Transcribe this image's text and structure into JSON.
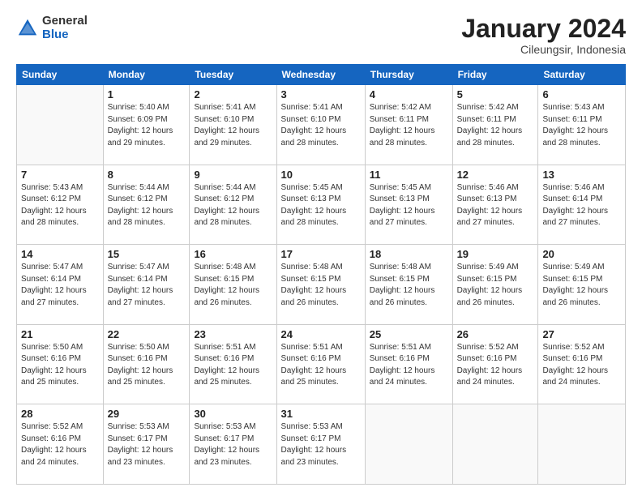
{
  "logo": {
    "general": "General",
    "blue": "Blue"
  },
  "header": {
    "month": "January 2024",
    "location": "Cileungsir, Indonesia"
  },
  "weekdays": [
    "Sunday",
    "Monday",
    "Tuesday",
    "Wednesday",
    "Thursday",
    "Friday",
    "Saturday"
  ],
  "weeks": [
    [
      {
        "day": "",
        "info": ""
      },
      {
        "day": "1",
        "info": "Sunrise: 5:40 AM\nSunset: 6:09 PM\nDaylight: 12 hours\nand 29 minutes."
      },
      {
        "day": "2",
        "info": "Sunrise: 5:41 AM\nSunset: 6:10 PM\nDaylight: 12 hours\nand 29 minutes."
      },
      {
        "day": "3",
        "info": "Sunrise: 5:41 AM\nSunset: 6:10 PM\nDaylight: 12 hours\nand 28 minutes."
      },
      {
        "day": "4",
        "info": "Sunrise: 5:42 AM\nSunset: 6:11 PM\nDaylight: 12 hours\nand 28 minutes."
      },
      {
        "day": "5",
        "info": "Sunrise: 5:42 AM\nSunset: 6:11 PM\nDaylight: 12 hours\nand 28 minutes."
      },
      {
        "day": "6",
        "info": "Sunrise: 5:43 AM\nSunset: 6:11 PM\nDaylight: 12 hours\nand 28 minutes."
      }
    ],
    [
      {
        "day": "7",
        "info": "Sunrise: 5:43 AM\nSunset: 6:12 PM\nDaylight: 12 hours\nand 28 minutes."
      },
      {
        "day": "8",
        "info": "Sunrise: 5:44 AM\nSunset: 6:12 PM\nDaylight: 12 hours\nand 28 minutes."
      },
      {
        "day": "9",
        "info": "Sunrise: 5:44 AM\nSunset: 6:12 PM\nDaylight: 12 hours\nand 28 minutes."
      },
      {
        "day": "10",
        "info": "Sunrise: 5:45 AM\nSunset: 6:13 PM\nDaylight: 12 hours\nand 28 minutes."
      },
      {
        "day": "11",
        "info": "Sunrise: 5:45 AM\nSunset: 6:13 PM\nDaylight: 12 hours\nand 27 minutes."
      },
      {
        "day": "12",
        "info": "Sunrise: 5:46 AM\nSunset: 6:13 PM\nDaylight: 12 hours\nand 27 minutes."
      },
      {
        "day": "13",
        "info": "Sunrise: 5:46 AM\nSunset: 6:14 PM\nDaylight: 12 hours\nand 27 minutes."
      }
    ],
    [
      {
        "day": "14",
        "info": "Sunrise: 5:47 AM\nSunset: 6:14 PM\nDaylight: 12 hours\nand 27 minutes."
      },
      {
        "day": "15",
        "info": "Sunrise: 5:47 AM\nSunset: 6:14 PM\nDaylight: 12 hours\nand 27 minutes."
      },
      {
        "day": "16",
        "info": "Sunrise: 5:48 AM\nSunset: 6:15 PM\nDaylight: 12 hours\nand 26 minutes."
      },
      {
        "day": "17",
        "info": "Sunrise: 5:48 AM\nSunset: 6:15 PM\nDaylight: 12 hours\nand 26 minutes."
      },
      {
        "day": "18",
        "info": "Sunrise: 5:48 AM\nSunset: 6:15 PM\nDaylight: 12 hours\nand 26 minutes."
      },
      {
        "day": "19",
        "info": "Sunrise: 5:49 AM\nSunset: 6:15 PM\nDaylight: 12 hours\nand 26 minutes."
      },
      {
        "day": "20",
        "info": "Sunrise: 5:49 AM\nSunset: 6:15 PM\nDaylight: 12 hours\nand 26 minutes."
      }
    ],
    [
      {
        "day": "21",
        "info": "Sunrise: 5:50 AM\nSunset: 6:16 PM\nDaylight: 12 hours\nand 25 minutes."
      },
      {
        "day": "22",
        "info": "Sunrise: 5:50 AM\nSunset: 6:16 PM\nDaylight: 12 hours\nand 25 minutes."
      },
      {
        "day": "23",
        "info": "Sunrise: 5:51 AM\nSunset: 6:16 PM\nDaylight: 12 hours\nand 25 minutes."
      },
      {
        "day": "24",
        "info": "Sunrise: 5:51 AM\nSunset: 6:16 PM\nDaylight: 12 hours\nand 25 minutes."
      },
      {
        "day": "25",
        "info": "Sunrise: 5:51 AM\nSunset: 6:16 PM\nDaylight: 12 hours\nand 24 minutes."
      },
      {
        "day": "26",
        "info": "Sunrise: 5:52 AM\nSunset: 6:16 PM\nDaylight: 12 hours\nand 24 minutes."
      },
      {
        "day": "27",
        "info": "Sunrise: 5:52 AM\nSunset: 6:16 PM\nDaylight: 12 hours\nand 24 minutes."
      }
    ],
    [
      {
        "day": "28",
        "info": "Sunrise: 5:52 AM\nSunset: 6:16 PM\nDaylight: 12 hours\nand 24 minutes."
      },
      {
        "day": "29",
        "info": "Sunrise: 5:53 AM\nSunset: 6:17 PM\nDaylight: 12 hours\nand 23 minutes."
      },
      {
        "day": "30",
        "info": "Sunrise: 5:53 AM\nSunset: 6:17 PM\nDaylight: 12 hours\nand 23 minutes."
      },
      {
        "day": "31",
        "info": "Sunrise: 5:53 AM\nSunset: 6:17 PM\nDaylight: 12 hours\nand 23 minutes."
      },
      {
        "day": "",
        "info": ""
      },
      {
        "day": "",
        "info": ""
      },
      {
        "day": "",
        "info": ""
      }
    ]
  ]
}
